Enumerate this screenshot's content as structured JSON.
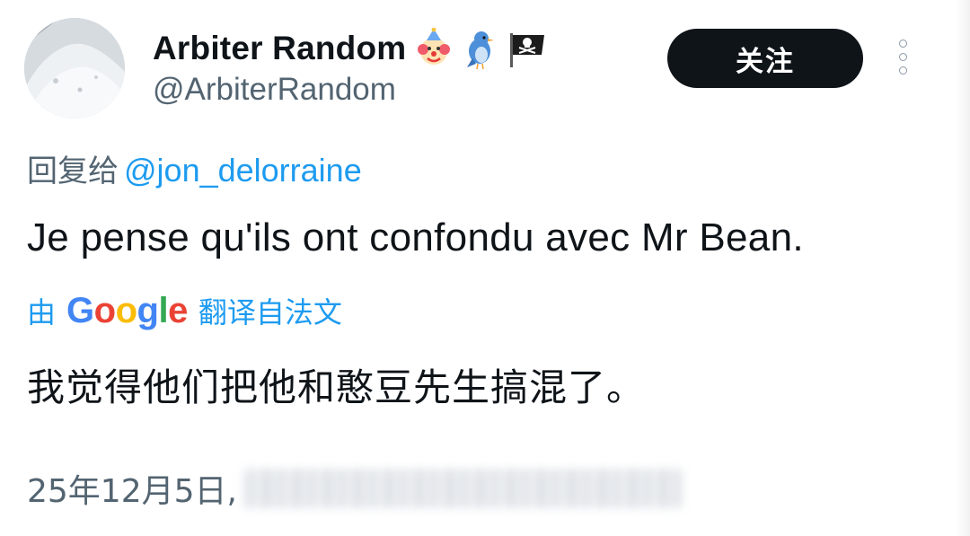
{
  "user": {
    "display_name": "Arbiter Random",
    "handle": "@ArbiterRandom",
    "badges": [
      "clown-emoji-icon",
      "bird-emoji-icon",
      "pirate-flag-emoji-icon"
    ]
  },
  "follow_button": {
    "label": "关注"
  },
  "reply": {
    "prefix": "回复给",
    "mention": "@jon_delorraine"
  },
  "tweet": {
    "text": "Je pense qu'ils ont confondu avec Mr Bean."
  },
  "translation": {
    "prefix": "由",
    "provider": "Google",
    "suffix": "翻译自法文",
    "text": "我觉得他们把他和憨豆先生搞混了。"
  },
  "meta": {
    "date": "25年12月5日,"
  },
  "colors": {
    "link": "#1d9bf0",
    "secondary_text": "#536471",
    "primary_text": "#0f1419",
    "button_bg": "#0f1419"
  }
}
